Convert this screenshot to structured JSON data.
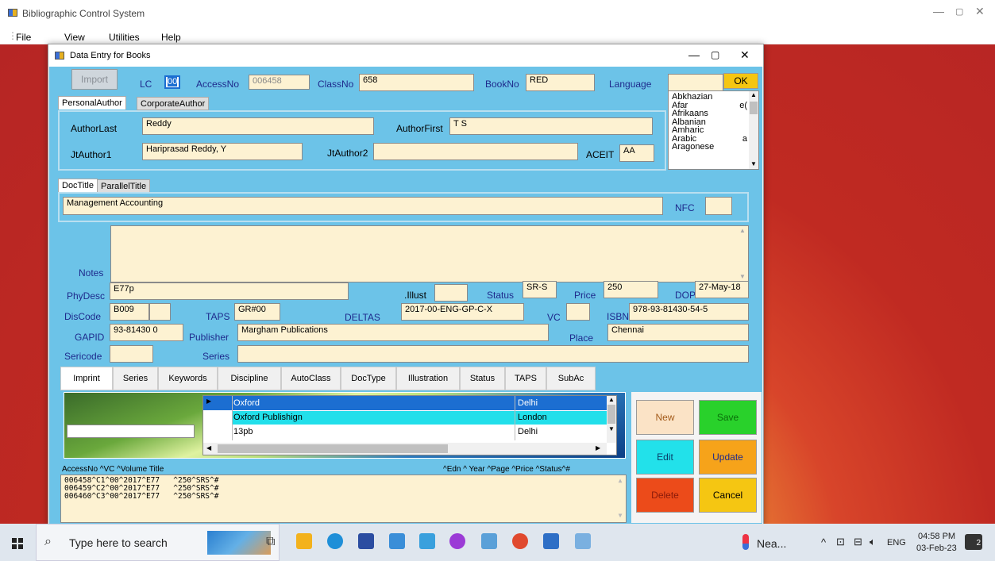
{
  "app": {
    "title": "Bibliographic Control System",
    "menu": [
      "File",
      "View",
      "Utilities",
      "Help"
    ]
  },
  "dialog": {
    "title": "Data Entry for Books",
    "import_label": "Import",
    "lc_label": "LC",
    "lc_value": "00",
    "accessno_label": "AccessNo",
    "accessno_value": "006458",
    "classno_label": "ClassNo",
    "classno_value": "658",
    "bookno_label": "BookNo",
    "bookno_value": "RED",
    "language_label": "Language",
    "ok_label": "OK",
    "languages": [
      {
        "name": "Abkhazian",
        "code": ""
      },
      {
        "name": "Afar",
        "code": "e("
      },
      {
        "name": "Afrikaans",
        "code": ""
      },
      {
        "name": "Albanian",
        "code": ""
      },
      {
        "name": "Amharic",
        "code": ""
      },
      {
        "name": "Arabic",
        "code": "a"
      },
      {
        "name": "Aragonese",
        "code": ""
      }
    ],
    "author_tabs": [
      "PersonalAuthor",
      "CorporateAuthor"
    ],
    "authorlast_label": "AuthorLast",
    "authorlast_value": "Reddy",
    "authorfirst_label": "AuthorFirst",
    "authorfirst_value": "T S",
    "jtauthor1_label": "JtAuthor1",
    "jtauthor1_value": "Hariprasad Reddy, Y",
    "jtauthor2_label": "JtAuthor2",
    "jtauthor2_value": "",
    "aceit_label": "ACEIT",
    "aceit_value": "AA",
    "title_tabs": [
      "DocTitle",
      "ParallelTitle"
    ],
    "doctitle_value": "Management Accounting",
    "nfc_label": "NFC",
    "nfc_value": "",
    "notes_label": "Notes",
    "notes_value": "",
    "phydesc_label": "PhyDesc",
    "phydesc_value": "E77p",
    "illust_label": ".Illust",
    "illust_value": "",
    "status_label": "Status",
    "status_value": "SR-S",
    "price_label": "Price",
    "price_value": "250",
    "dop_label": "DOP",
    "dop_value": "27-May-18",
    "discode_label": "DisCode",
    "discode_value": "B009",
    "taps_label": "TAPS",
    "taps_value": "GR#00",
    "deltas_label": "DELTAS",
    "deltas_value": "2017-00-ENG-GP-C-X",
    "vc_label": "VC",
    "vc_value": "",
    "isbn_label": "ISBN",
    "isbn_value": "978-93-81430-54-5",
    "gapid_label": "GAPID",
    "gapid_value": "93-81430 0",
    "publisher_label": "Publisher",
    "publisher_value": "Margham Publications",
    "place_label": "Place",
    "place_value": "Chennai",
    "sericode_label": "Sericode",
    "series_label": "Series",
    "lower_tabs": [
      "Imprint",
      "Series",
      "Keywords",
      "Discipline",
      "AutoClass",
      "DocType",
      "Illustration",
      "Status",
      "TAPS",
      "SubAc"
    ],
    "imprint_rows": [
      {
        "publisher": "Oxford",
        "place": "Delhi"
      },
      {
        "publisher": "Oxford Publishign",
        "place": "London"
      },
      {
        "publisher": "13pb",
        "place": "Delhi"
      }
    ],
    "buttons": {
      "new": "New",
      "save": "Save",
      "edit": "Edit",
      "update": "Update",
      "delete": "Delete",
      "cancel": "Cancel"
    },
    "list_header_left": "AccessNo  ^VC  ^Volume Title",
    "list_header_right": "^Edn  ^ Year ^Page ^Price ^Status^#",
    "records": [
      "006458^C1^00^2017^E77   ^250^SRS^#",
      "006459^C2^00^2017^E77   ^250^SRS^#",
      "006460^C3^00^2017^E77   ^250^SRS^#"
    ]
  },
  "taskbar": {
    "search_placeholder": "Type here to search",
    "weather": "Nea...",
    "lang": "ENG",
    "time": "04:58 PM",
    "date": "03-Feb-23",
    "notif_count": "2"
  },
  "colors": {
    "form_bg": "#6cc3e8",
    "field_bg": "#fdf2d2",
    "new": "#fbe3c6",
    "save": "#29d12b",
    "edit": "#22e1ea",
    "update": "#f6a31a",
    "delete": "#ec4b1a",
    "cancel": "#f5c612",
    "selected_row": "#1c6ed1",
    "alt_row": "#22dfea"
  }
}
